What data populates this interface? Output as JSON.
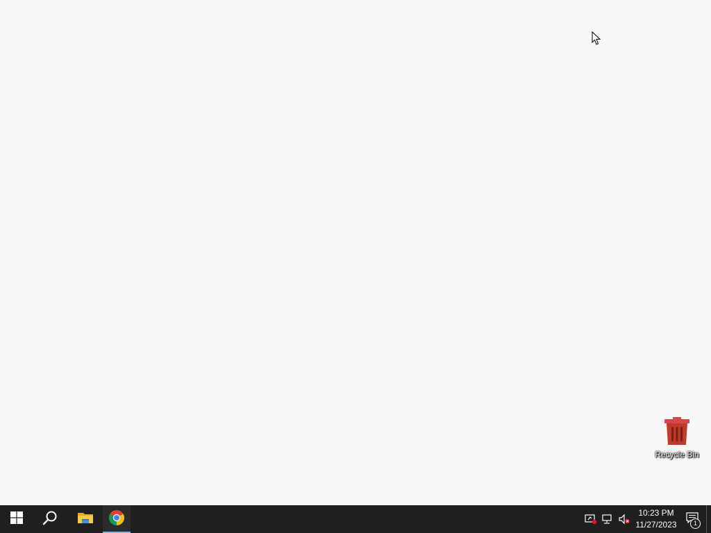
{
  "desktop": {
    "icons": [
      {
        "label": "Recycle Bin",
        "icon": "recycle-bin-icon"
      }
    ]
  },
  "taskbar": {
    "start": {
      "icon": "windows-logo-icon"
    },
    "search": {
      "icon": "search-icon"
    },
    "pinned": [
      {
        "name": "File Explorer",
        "icon": "file-explorer-icon",
        "active": false
      },
      {
        "name": "Google Chrome",
        "icon": "chrome-icon",
        "active": true
      }
    ],
    "tray": {
      "icons": [
        "security-alert-icon",
        "network-icon",
        "volume-muted-icon"
      ],
      "time": "10:23 PM",
      "date": "11/27/2023",
      "notification_count": "1"
    }
  },
  "colors": {
    "desktop_background": "#f7f7f7",
    "taskbar_background": "#1f1f1f",
    "active_indicator": "#78b7ee",
    "recycle_bin": "#c0392b"
  }
}
